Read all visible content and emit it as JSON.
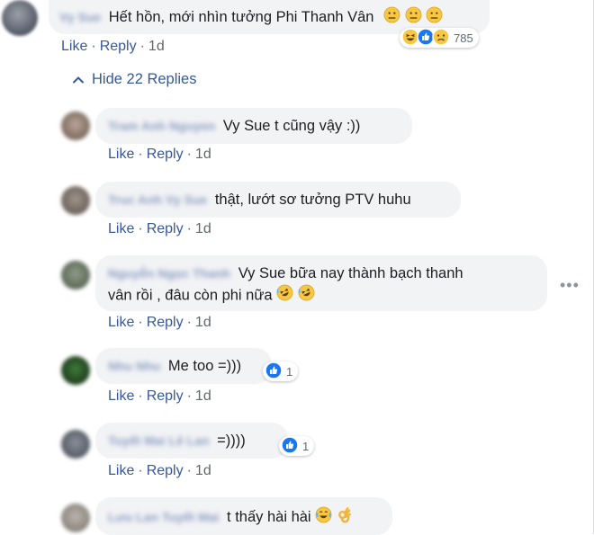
{
  "top_comment": {
    "author": "Vy Sue",
    "text": "Hết hồn, mới nhìn tưởng Phi Thanh Vân",
    "actions": {
      "like": "Like",
      "reply": "Reply",
      "time": "1d"
    },
    "reaction_count": "785",
    "reactions": [
      "haha-icon",
      "like-icon",
      "sad-icon"
    ]
  },
  "hide_replies_label": "Hide 22 Replies",
  "replies": [
    {
      "author": "Tram Anh Nguyen",
      "text": "Vy Sue t cũng vậy :))",
      "like": "Like",
      "reply": "Reply",
      "time": "1d"
    },
    {
      "author": "Truc Anh Vy Sue",
      "text": "thật, lướt sơ tưởng PTV huhu",
      "like": "Like",
      "reply": "Reply",
      "time": "1d"
    },
    {
      "author": "Nguyễn Ngọc Thanh",
      "text_line1": "Vy Sue bữa nay thành bạch thanh",
      "text_line2": "vân rồi , đâu còn phi nữa",
      "like": "Like",
      "reply": "Reply",
      "time": "1d"
    },
    {
      "author": "Nhu Nhu",
      "text": "Me too =)))",
      "reaction_count": "1",
      "like": "Like",
      "reply": "Reply",
      "time": "1d"
    },
    {
      "author": "Tuyết Mai Lê Lan",
      "text": "=))))",
      "reaction_count": "1",
      "like": "Like",
      "reply": "Reply",
      "time": "1d"
    },
    {
      "author": "Lưu Lan Tuyết Mai",
      "text": "t thấy hài hài"
    }
  ],
  "colors": {
    "link": "#385898",
    "bubble": "#f2f3f5",
    "meta": "#606770",
    "like_blue": "#1877f2"
  }
}
